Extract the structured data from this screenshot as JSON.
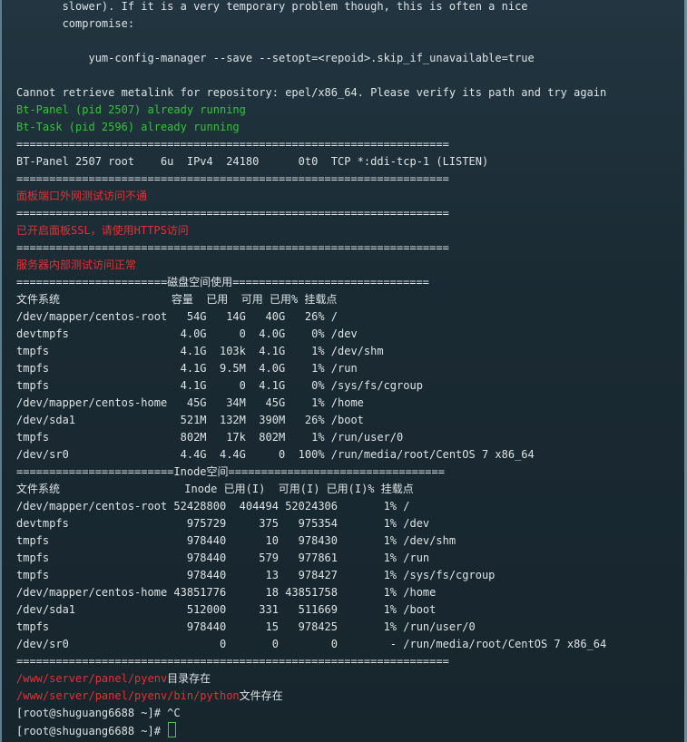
{
  "terminal": {
    "lines": [
      {
        "text": "       slower). If it is a very temporary problem though, this is often a nice",
        "color": "default"
      },
      {
        "text": "       compromise:",
        "color": "default"
      },
      {
        "text": "",
        "color": "default"
      },
      {
        "text": "           yum-config-manager --save --setopt=<repoid>.skip_if_unavailable=true",
        "color": "default"
      },
      {
        "text": "",
        "color": "default"
      },
      {
        "text": "Cannot retrieve metalink for repository: epel/x86_64. Please verify its path and try again",
        "color": "default"
      },
      {
        "text": "Bt-Panel (pid 2507) already running",
        "color": "green"
      },
      {
        "text": "Bt-Task (pid 2596) already running",
        "color": "green"
      },
      {
        "text": "==================================================================",
        "color": "default"
      },
      {
        "text": "BT-Panel 2507 root    6u  IPv4  24180      0t0  TCP *:ddi-tcp-1 (LISTEN)",
        "color": "default"
      },
      {
        "text": "==================================================================",
        "color": "default"
      },
      {
        "text": "面板端口外网测试访问不通",
        "color": "red"
      },
      {
        "text": "==================================================================",
        "color": "default"
      },
      {
        "text": "已开启面板SSL，请使用HTTPS访问",
        "color": "red"
      },
      {
        "text": "==================================================================",
        "color": "default"
      },
      {
        "text": "服务器内部测试访问正常",
        "color": "red"
      },
      {
        "text": "=======================磁盘空间使用==============================",
        "color": "default"
      },
      {
        "text": "文件系统                 容量  已用  可用 已用% 挂载点",
        "color": "default"
      },
      {
        "text": "/dev/mapper/centos-root   54G   14G   40G   26% /",
        "color": "default"
      },
      {
        "text": "devtmpfs                 4.0G     0  4.0G    0% /dev",
        "color": "default"
      },
      {
        "text": "tmpfs                    4.1G  103k  4.1G    1% /dev/shm",
        "color": "default"
      },
      {
        "text": "tmpfs                    4.1G  9.5M  4.0G    1% /run",
        "color": "default"
      },
      {
        "text": "tmpfs                    4.1G     0  4.1G    0% /sys/fs/cgroup",
        "color": "default"
      },
      {
        "text": "/dev/mapper/centos-home   45G   34M   45G    1% /home",
        "color": "default"
      },
      {
        "text": "/dev/sda1                521M  132M  390M   26% /boot",
        "color": "default"
      },
      {
        "text": "tmpfs                    802M   17k  802M    1% /run/user/0",
        "color": "default"
      },
      {
        "text": "/dev/sr0                 4.4G  4.4G     0  100% /run/media/root/CentOS 7 x86_64",
        "color": "default"
      },
      {
        "text": "========================Inode空间=================================",
        "color": "default"
      },
      {
        "text": "文件系统                   Inode 已用(I)  可用(I) 已用(I)% 挂载点",
        "color": "default"
      },
      {
        "text": "/dev/mapper/centos-root 52428800  404494 52024306       1% /",
        "color": "default"
      },
      {
        "text": "devtmpfs                  975729     375   975354       1% /dev",
        "color": "default"
      },
      {
        "text": "tmpfs                     978440      10   978430       1% /dev/shm",
        "color": "default"
      },
      {
        "text": "tmpfs                     978440     579   977861       1% /run",
        "color": "default"
      },
      {
        "text": "tmpfs                     978440      13   978427       1% /sys/fs/cgroup",
        "color": "default"
      },
      {
        "text": "/dev/mapper/centos-home 43851776      18 43851758       1% /home",
        "color": "default"
      },
      {
        "text": "/dev/sda1                 512000     331   511669       1% /boot",
        "color": "default"
      },
      {
        "text": "tmpfs                     978440      15   978425       1% /run/user/0",
        "color": "default"
      },
      {
        "text": "/dev/sr0                       0       0        0        - /run/media/root/CentOS 7 x86_64",
        "color": "default"
      },
      {
        "text": "==================================================================",
        "color": "default"
      }
    ],
    "pyenv_dir": {
      "path": "/www/server/panel/pyenv",
      "suffix": "目录存在"
    },
    "pyenv_bin": {
      "path": "/www/server/panel/pyenv/bin/python",
      "suffix": "文件存在"
    },
    "prompt1": "[root@shuguang6688 ~]# ^C",
    "prompt2": "[root@shuguang6688 ~]# "
  },
  "colors": {
    "default": "#dde3e6",
    "green": "#34c534",
    "red": "#e53030",
    "cursor": "#3ad13a"
  }
}
